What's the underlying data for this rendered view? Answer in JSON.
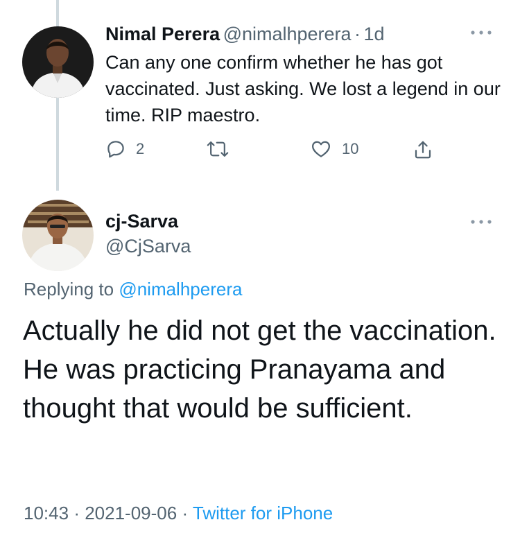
{
  "colors": {
    "text": "#0f1419",
    "secondary": "#536471",
    "link": "#1d9bf0",
    "thread_line": "#cfd9de"
  },
  "tweet1": {
    "name": "Nimal Perera",
    "handle": "@nimalhperera",
    "separator": "·",
    "time": "1d",
    "text": "Can any one confirm whether he has got vaccinated. Just asking. We lost a legend in our time. RIP maestro.",
    "actions": {
      "reply": {
        "icon": "reply-icon",
        "count": "2"
      },
      "retweet": {
        "icon": "retweet-icon",
        "count": ""
      },
      "like": {
        "icon": "heart-icon",
        "count": "10"
      },
      "share": {
        "icon": "share-icon"
      }
    }
  },
  "tweet2": {
    "name": "cj-Sarva",
    "handle": "@CjSarva",
    "replying_prefix": "Replying to ",
    "replying_handle": "@nimalhperera",
    "text": "Actually he did not get the vaccination. He was practicing Pranayama and thought that would be sufficient.",
    "meta": {
      "time": "10:43",
      "sep1": "·",
      "date": "2021-09-06",
      "sep2": "·",
      "source": "Twitter for iPhone"
    }
  }
}
